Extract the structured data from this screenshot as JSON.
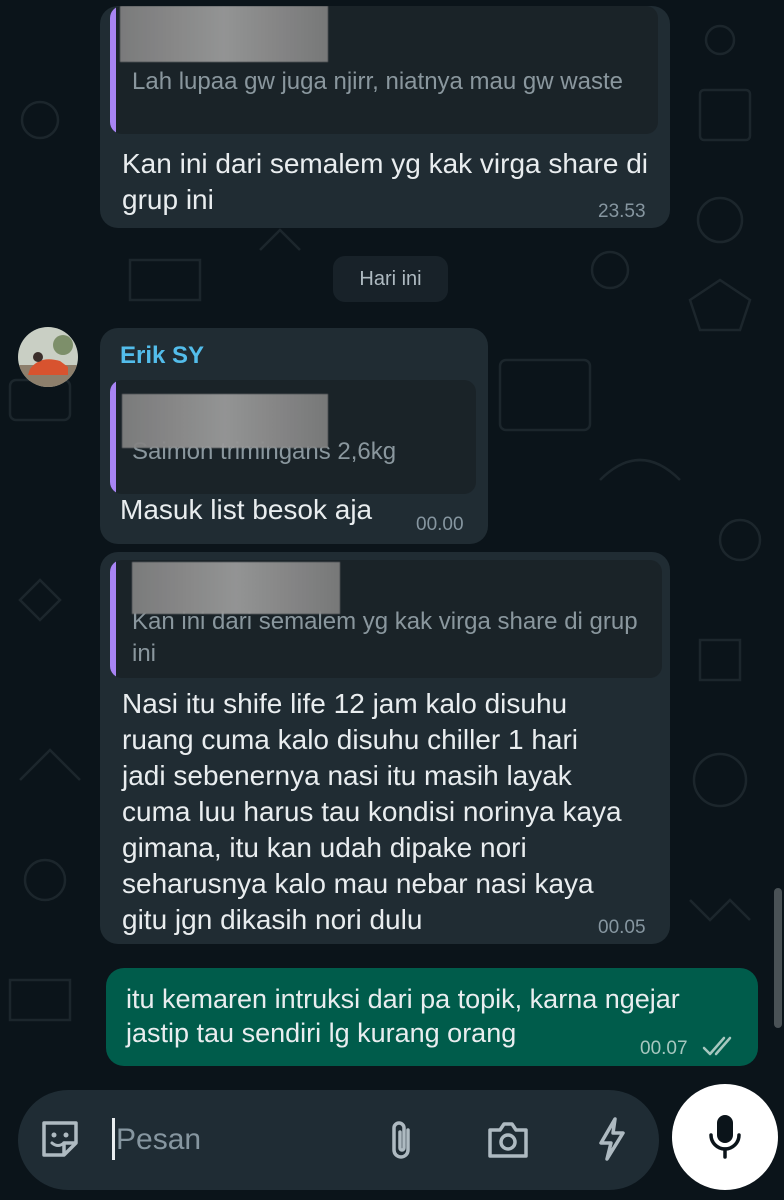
{
  "messages": [
    {
      "quote_text": "Lah lupaa gw juga njirr, niatnya  mau gw waste",
      "text": "Kan ini dari semalem yg kak virga share di grup ini",
      "time": "23.53"
    },
    {
      "sender": "Erik SY",
      "quote_text": "Saimon trimingans 2,6kg",
      "text": "Masuk list besok aja",
      "time": "00.00"
    },
    {
      "quote_text": "Kan ini dari semalem yg kak virga share di grup ini",
      "text": "Nasi itu shife life 12 jam kalo disuhu ruang cuma kalo disuhu chiller 1 hari jadi sebenernya nasi itu masih layak cuma luu harus tau kondisi norinya kaya gimana, itu kan udah dipake nori seharusnya kalo mau nebar nasi kaya gitu jgn dikasih nori dulu",
      "time": "00.05"
    },
    {
      "text": "itu kemaren intruksi dari pa topik, karna ngejar jastip tau sendiri lg kurang orang",
      "time": "00.07",
      "status": "read"
    }
  ],
  "date_chip": "Hari ini",
  "composer": {
    "placeholder": "Pesan"
  },
  "icons": {
    "emoji": "sticker-icon",
    "attach": "paperclip-icon",
    "camera": "camera-icon",
    "flash": "lightning-icon",
    "mic": "microphone-icon",
    "ticks": "double-check-icon"
  },
  "colors": {
    "background": "#0b141a",
    "incoming_bubble": "#202c33",
    "outgoing_bubble": "#005c4b",
    "quote_bar": "#a884f3",
    "sender_name": "#53bdeb",
    "read_ticks": "#a6c7bf"
  }
}
